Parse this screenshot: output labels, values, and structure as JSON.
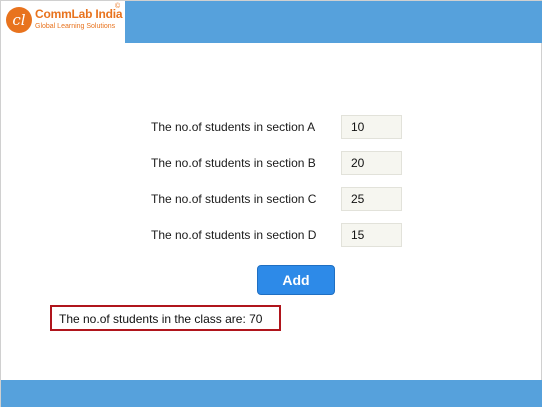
{
  "brand": {
    "mark": "cl",
    "name": "CommLab India",
    "registered": "©",
    "tagline": "Global Learning Solutions"
  },
  "form": {
    "rows": [
      {
        "label": "The no.of students in section A",
        "value": "10"
      },
      {
        "label": "The no.of students in section B",
        "value": "20"
      },
      {
        "label": "The no.of students in section C",
        "value": "25"
      },
      {
        "label": "The no.of students in section D",
        "value": "15"
      }
    ],
    "add_label": "Add"
  },
  "result": {
    "text": "The no.of students in the class are: 70"
  },
  "colors": {
    "header_bar": "#56a1dc",
    "brand_orange": "#e8731e",
    "button": "#2d8ae8",
    "result_border": "#b0151c"
  }
}
